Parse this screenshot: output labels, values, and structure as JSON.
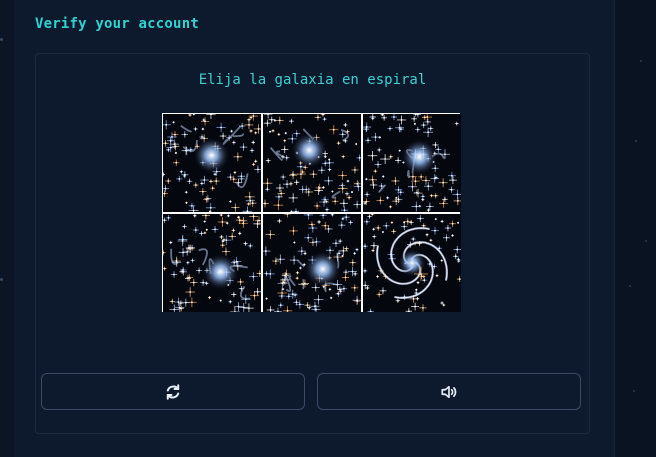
{
  "header": {
    "title": "Verify your account"
  },
  "captcha": {
    "prompt": "Elija la galaxia en espiral",
    "tiles": [
      {
        "kind": "elliptical"
      },
      {
        "kind": "elliptical"
      },
      {
        "kind": "elliptical"
      },
      {
        "kind": "elliptical"
      },
      {
        "kind": "elliptical"
      },
      {
        "kind": "spiral"
      }
    ],
    "refresh_icon": "refresh-icon",
    "audio_icon": "speaker-icon"
  },
  "colors": {
    "accent": "#2fd3d0",
    "background": "#0a1424",
    "panel": "#0d1a2e",
    "button_border": "#3c4a63"
  }
}
